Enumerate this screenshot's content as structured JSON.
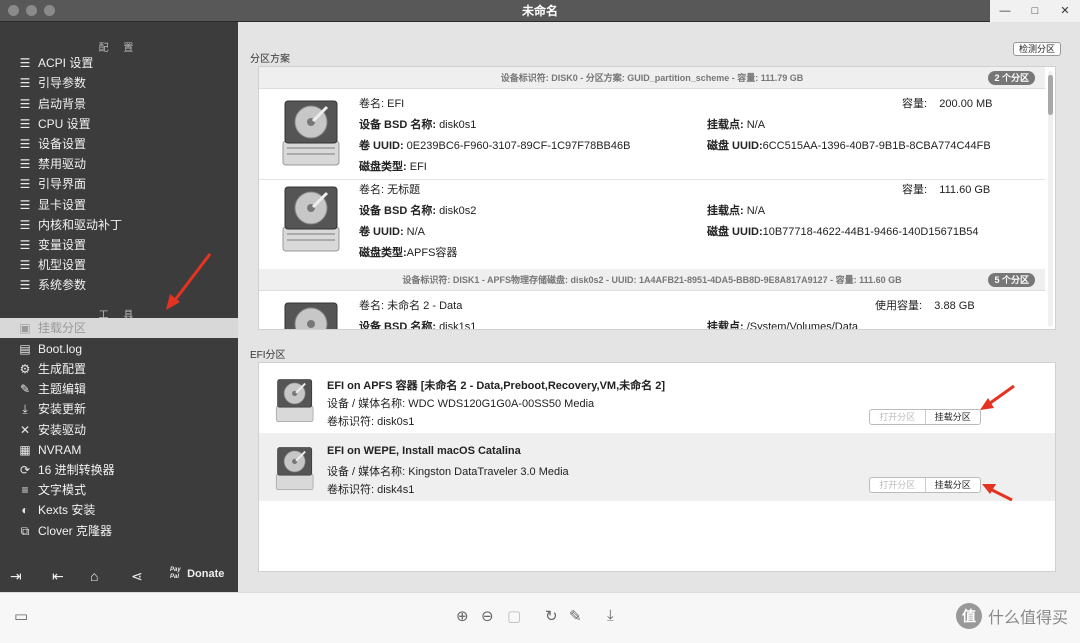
{
  "window": {
    "title": "未命名",
    "controls": [
      "—",
      "□",
      "✕"
    ]
  },
  "sidebar": {
    "config_header": "配 置",
    "config_items": [
      {
        "icon": "list-icon",
        "label": "ACPI 设置"
      },
      {
        "icon": "list-icon",
        "label": "引导参数"
      },
      {
        "icon": "list-icon",
        "label": "启动背景"
      },
      {
        "icon": "list-icon",
        "label": "CPU 设置"
      },
      {
        "icon": "list-icon",
        "label": "设备设置"
      },
      {
        "icon": "list-icon",
        "label": "禁用驱动"
      },
      {
        "icon": "list-icon",
        "label": "引导界面"
      },
      {
        "icon": "list-icon",
        "label": "显卡设置"
      },
      {
        "icon": "list-icon",
        "label": "内核和驱动补丁"
      },
      {
        "icon": "list-icon",
        "label": "变量设置"
      },
      {
        "icon": "list-icon",
        "label": "机型设置"
      },
      {
        "icon": "list-icon",
        "label": "系统参数"
      }
    ],
    "tools_header": "工 具",
    "tool_items": [
      {
        "icon": "disk-icon",
        "label": "挂载分区",
        "active": true
      },
      {
        "icon": "log-icon",
        "label": "Boot.log"
      },
      {
        "icon": "gear-icon",
        "label": "生成配置"
      },
      {
        "icon": "brush-icon",
        "label": "主题编辑"
      },
      {
        "icon": "download-icon",
        "label": "安装更新"
      },
      {
        "icon": "wrench-icon",
        "label": "安装驱动"
      },
      {
        "icon": "chip-icon",
        "label": "NVRAM"
      },
      {
        "icon": "refresh-icon",
        "label": "16 进制转换器"
      },
      {
        "icon": "text-icon",
        "label": "文字模式"
      },
      {
        "icon": "kext-icon",
        "label": "Kexts 安装"
      },
      {
        "icon": "clone-icon",
        "label": "Clover 克隆器"
      }
    ],
    "donate_label": "Donate",
    "paypal_label": "Pay Pal"
  },
  "main": {
    "scheme_label": "分区方案",
    "detect_button": "检测分区",
    "disk0": {
      "header": "设备标识符: DISK0 - 分区方案: GUID_partition_scheme - 容量: 111.79 GB",
      "badge": "2 个分区",
      "volumes": [
        {
          "name_label": "卷名:",
          "name": "EFI",
          "capacity_label": "容量:",
          "capacity": "200.00 MB",
          "bsd_label": "设备 BSD 名称:",
          "bsd": "disk0s1",
          "mount_label": "挂载点:",
          "mount": "N/A",
          "uuid_label": "卷 UUID:",
          "uuid": "0E239BC6-F960-3107-89CF-1C97F78BB46B",
          "disk_uuid_label": "磁盘 UUID:",
          "disk_uuid": "6CC515AA-1396-40B7-9B1B-8CBA774C44FB",
          "type_label": "磁盘类型:",
          "type": "EFI"
        },
        {
          "name_label": "卷名:",
          "name": "无标题",
          "capacity_label": "容量:",
          "capacity": "111.60 GB",
          "bsd_label": "设备 BSD 名称:",
          "bsd": "disk0s2",
          "mount_label": "挂载点:",
          "mount": "N/A",
          "uuid_label": "卷 UUID:",
          "uuid": "N/A",
          "disk_uuid_label": "磁盘 UUID:",
          "disk_uuid": "10B77718-4622-44B1-9466-140D15671B54",
          "type_label": "磁盘类型:",
          "type": "APFS容器"
        }
      ]
    },
    "disk1": {
      "header": "设备标识符: DISK1 - APFS物理存储磁盘: disk0s2 - UUID: 1A4AFB21-8951-4DA5-BB8D-9E8A817A9127 - 容量: 111.60 GB",
      "badge": "5 个分区",
      "volume": {
        "name_label": "卷名:",
        "name": "未命名 2 - Data",
        "used_label": "使用容量:",
        "used": "3.88 GB",
        "bsd_label": "设备 BSD 名称:",
        "bsd": "disk1s1",
        "mount_label": "挂载点:",
        "mount": "/System/Volumes/Data"
      }
    },
    "efi_label": "EFI分区",
    "efi_items": [
      {
        "title": "EFI on APFS 容器 [未命名 2 - Data,Preboot,Recovery,VM,未命名 2]",
        "media": "设备 / 媒体名称: WDC WDS120G1G0A-00SS50 Media",
        "id": "卷标识符: disk0s1",
        "open_button": "打开分区",
        "mount_button": "挂载分区"
      },
      {
        "title": "EFI on WEPE, Install macOS Catalina",
        "media": "设备 / 媒体名称: Kingston DataTraveler 3.0 Media",
        "id": "卷标识符: disk4s1",
        "open_button": "打开分区",
        "mount_button": "挂载分区"
      }
    ]
  },
  "watermark": {
    "logo": "值",
    "text": "什么值得买"
  },
  "colors": {
    "sidebar_bg": "#3c3c3c",
    "active_item_bg": "#d8d8d8",
    "arrow": "#e53322",
    "badge_bg": "#777777"
  }
}
